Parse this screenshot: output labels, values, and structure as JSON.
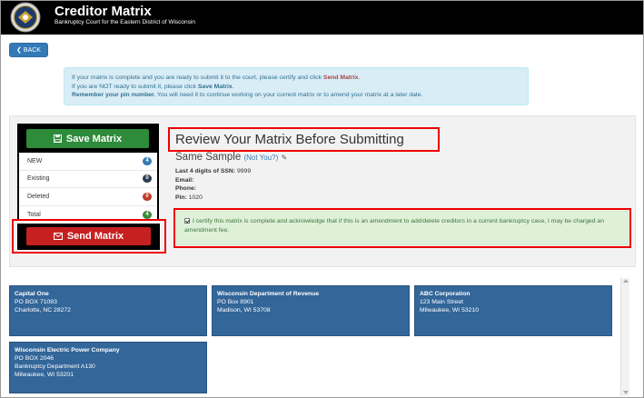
{
  "header": {
    "title": "Creditor Matrix",
    "subtitle": "Bankruptcy Court for the Eastern District of Wisconsin"
  },
  "back_label": "BACK",
  "info": {
    "line1_pre": "If your matrix is complete and you are ready to submit it to the court, please certify and click ",
    "line1_action": "Send Matrix",
    "line1_post": ".",
    "line2_pre": "If you are NOT ready to submit it, please click ",
    "line2_action": "Save Matrix",
    "line2_post": ".",
    "line3_bold": "Remember your pin number.",
    "line3_rest": " You will need it to continue working on your current matrix or to amend your matrix at a later date."
  },
  "save_label": "Save Matrix",
  "send_label": "Send Matrix",
  "counts": [
    {
      "label": "NEW",
      "value": "4",
      "color": "#337ab7"
    },
    {
      "label": "Existing",
      "value": "0",
      "color": "#2b3e50"
    },
    {
      "label": "Deleted",
      "value": "0",
      "color": "#c0392b"
    },
    {
      "label": "Total",
      "value": "4",
      "color": "#3a8a3a"
    }
  ],
  "review_heading": "Review Your Matrix Before Submitting",
  "debtor": {
    "name": "Same Sample",
    "not_you": "(Not You?)",
    "ssn_label": "Last 4 digits of SSN:",
    "ssn_value": "9999",
    "email_label": "Email:",
    "email_value": "",
    "phone_label": "Phone:",
    "phone_value": "",
    "pin_label": "Pin:",
    "pin_value": "1020"
  },
  "certify_text": "I certify this matrix is complete and acknowledge that if this is an amendment to add/delete creditors in a current bankruptcy case, I may be charged an amendment fee.",
  "creditors": [
    {
      "name": "Capital One",
      "lines": [
        "PO BOX 71083",
        "Charlotte, NC 28272"
      ]
    },
    {
      "name": "Wisconsin Department of Revenue",
      "lines": [
        "PO Box 8901",
        "Madison, WI 53708"
      ]
    },
    {
      "name": "ABC Corporation",
      "lines": [
        "123 Main Street",
        "Milwaukee, WI 53210"
      ]
    },
    {
      "name": "Wisconsin Electric Power Company",
      "lines": [
        "PO BOX 2046",
        "Bankruptcy Department A130",
        "Milwaukee, WI 53201"
      ]
    }
  ],
  "colors": {
    "accent": "#337ab7",
    "save": "#2e8b3a",
    "send": "#c62020",
    "card": "#336699",
    "highlight": "#ee0000"
  }
}
